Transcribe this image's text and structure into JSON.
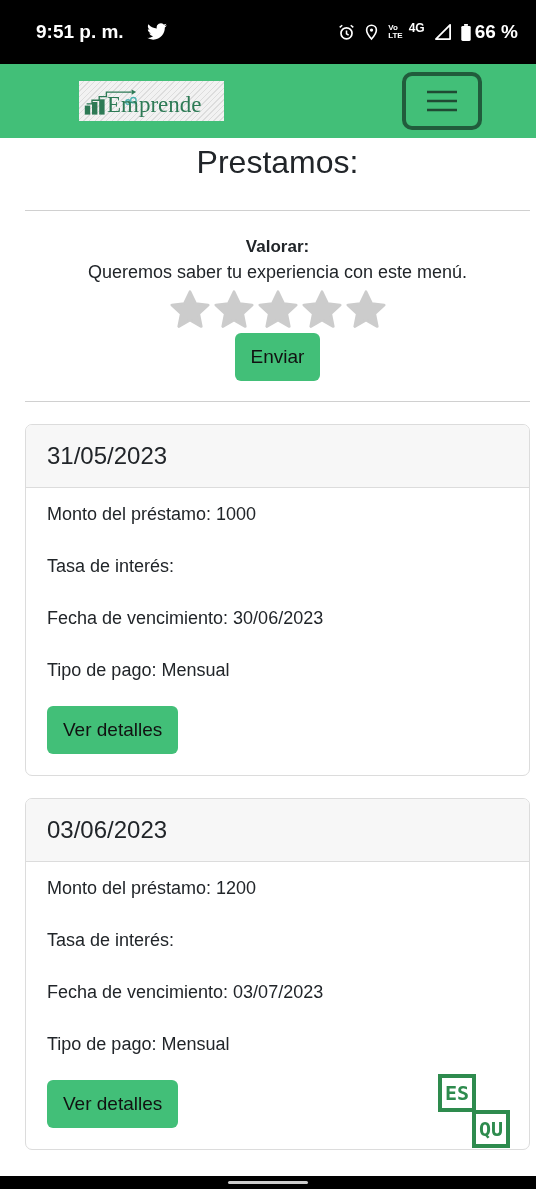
{
  "status_bar": {
    "time": "9:51 p. m.",
    "volte_top": "Vo",
    "volte_bottom": "LTE",
    "network": "4G",
    "battery": "66 %"
  },
  "header": {
    "logo_text": "Emprende"
  },
  "title": "Prestamos:",
  "rating": {
    "label": "Valorar:",
    "prompt": "Queremos saber tu experiencia con este menú.",
    "stars": 0,
    "button": "Enviar"
  },
  "loans": [
    {
      "date": "31/05/2023",
      "lines": [
        "Monto del préstamo: 1000",
        "Tasa de interés:",
        "Fecha de vencimiento: 30/06/2023",
        "Tipo de pago: Mensual"
      ],
      "button": "Ver detalles"
    },
    {
      "date": "03/06/2023",
      "lines": [
        "Monto del préstamo: 1200",
        "Tasa de interés:",
        "Fecha de vencimiento: 03/07/2023",
        "Tipo de pago: Mensual"
      ],
      "button": "Ver detalles"
    }
  ],
  "language_badge": {
    "top": "ES",
    "bottom": "QU"
  }
}
